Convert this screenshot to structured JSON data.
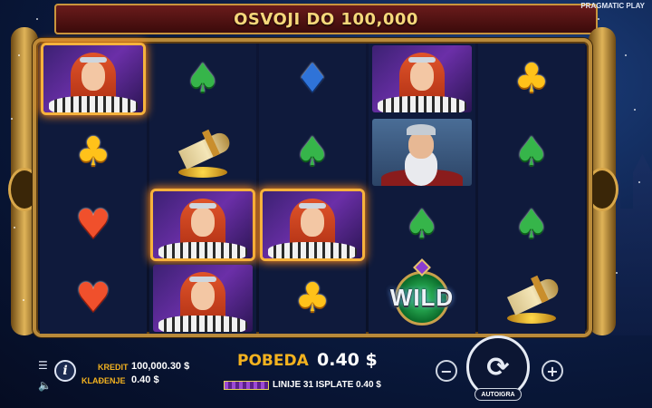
{
  "header": {
    "banner_text": "OSVOJI DO 100,000",
    "brand": "PRAGMATIC PLAY"
  },
  "reels": [
    [
      "queen",
      "club",
      "heart",
      "heart"
    ],
    [
      "spade",
      "horn",
      "queen",
      "queen"
    ],
    [
      "diamond",
      "spade",
      "queen",
      "club"
    ],
    [
      "queen",
      "king",
      "spade",
      "wild"
    ],
    [
      "club",
      "spade",
      "spade",
      "horn"
    ]
  ],
  "highlighted_cells": [
    [
      0,
      0
    ],
    [
      1,
      2
    ],
    [
      2,
      2
    ]
  ],
  "wild_label": "WILD",
  "hud": {
    "kredit_label": "KREDIT",
    "kredit_value": "100,000.30 $",
    "kladjenje_label": "KLAĐENJE",
    "kladjenje_value": "0.40 $",
    "pobeda_label": "POBEDA",
    "pobeda_value": "0.40 $",
    "lines_text": "LINIJE 31 ISPLATE 0.40 $",
    "autoigra_label": "AUTOIGRA",
    "minus_label": "−",
    "plus_label": "+",
    "spin_symbol": "⟳",
    "info_label": "i"
  },
  "colors": {
    "gold": "#c9953d",
    "accent": "#f3b21f",
    "banner_bg": "#6a1b1b"
  },
  "icons": {
    "menu": "hamburger-menu-icon",
    "sound": "speaker-icon",
    "info": "info-icon",
    "spin": "spin-arrows-icon"
  }
}
